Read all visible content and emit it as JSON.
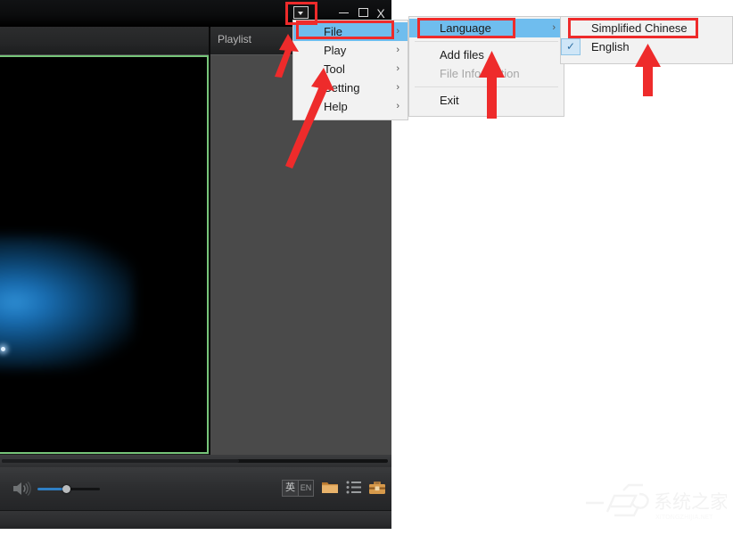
{
  "player": {
    "titlebar": {
      "menu_button": "menu-dropdown",
      "minimize": "minimize",
      "maximize": "maximize",
      "close": "X"
    },
    "playlist_title": "Playlist",
    "controls": {
      "volume_icon": "speaker-icon",
      "volume_percent": 45,
      "ime_cn_label": "英",
      "ime_en_label": "EN",
      "folder_icon": "folder-icon",
      "list_icon": "playlist-icon",
      "toolbox_icon": "toolbox-icon"
    },
    "progress_percent": 61
  },
  "menus": {
    "main": {
      "items": [
        {
          "label": "File",
          "submenu": true,
          "selected": true,
          "disabled": false
        },
        {
          "label": "Play",
          "submenu": true,
          "selected": false,
          "disabled": false
        },
        {
          "label": "Tool",
          "submenu": true,
          "selected": false,
          "disabled": false
        },
        {
          "label": "Setting",
          "submenu": true,
          "selected": false,
          "disabled": false
        },
        {
          "label": "Help",
          "submenu": true,
          "selected": false,
          "disabled": false
        }
      ]
    },
    "file": {
      "items": [
        {
          "label": "Language",
          "submenu": true,
          "selected": true,
          "disabled": false
        },
        {
          "label": "Add files",
          "submenu": false,
          "selected": false,
          "disabled": false
        },
        {
          "label": "File Information",
          "submenu": false,
          "selected": false,
          "disabled": true
        },
        {
          "label": "Exit",
          "submenu": false,
          "selected": false,
          "disabled": false
        }
      ]
    },
    "language": {
      "items": [
        {
          "label": "Simplified Chinese",
          "checked": false
        },
        {
          "label": "English",
          "checked": true
        }
      ],
      "check_glyph": "✓"
    },
    "submenu_arrow": "›"
  },
  "annotations": {
    "boxes": [
      {
        "name": "menu-button-highlight"
      },
      {
        "name": "file-item-highlight"
      },
      {
        "name": "language-item-highlight"
      },
      {
        "name": "simplified-chinese-highlight"
      }
    ],
    "arrow_color": "#ee2b2b"
  },
  "watermark": {
    "text": "系统之家"
  },
  "colors": {
    "menu_highlight": "#6fbdee",
    "annotation_red": "#ee2b2b",
    "video_border_green": "#76c479",
    "volume_blue": "#2f7fc4",
    "menu_background": "#f2f2f2"
  }
}
